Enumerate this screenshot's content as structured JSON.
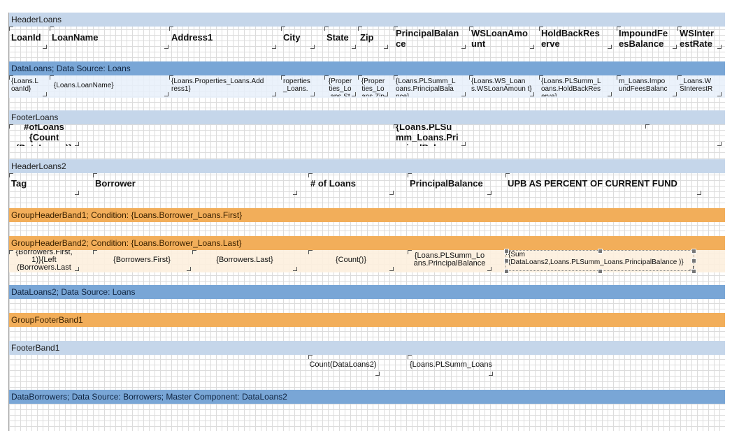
{
  "bands": {
    "header_loans": "HeaderLoans",
    "data_loans": "DataLoans; Data Source: Loans",
    "footer_loans": "FooterLoans",
    "header_loans2": "HeaderLoans2",
    "group_header_1": "GroupHeaderBand1; Condition: {Loans.Borrower_Loans.First}",
    "group_header_2": "GroupHeaderBand2; Condition: {Loans.Borrower_Loans.Last}",
    "data_loans2": "DataLoans2; Data Source: Loans",
    "group_footer_1": "GroupFooterBand1",
    "footer_band_1": "FooterBand1",
    "data_borrowers": "DataBorrowers; Data Source: Borrowers; Master Component: DataLoans2"
  },
  "header_loans": {
    "loan_id": "LoanId",
    "loan_name": "LoanName",
    "address1": "Address1",
    "city": "City",
    "state": "State",
    "zip": "Zip",
    "principal_balance": "PrincipalBalan ce",
    "ws_loan_amount": "WSLoanAmo unt",
    "holdback_reserve": "HoldBackRes erve",
    "impound_fees_balance": "ImpoundFe esBalance",
    "ws_interest_rate": "WSInter estRate"
  },
  "data_loans": {
    "loan_id": "{Loans.L oanId}",
    "loan_name": "{Loans.LoanName}",
    "address1": "{Loans.Properties_Loans.Add ress1}",
    "city": "roperties _Loans.",
    "state": "{Proper ties_Lo ans.St",
    "zip": "{Proper ties_Lo ans.Zip",
    "principal_balance": "{Loans.PLSumm_L oans.PrincipalBala nce}",
    "ws_loan_amount": "{Loans.WS_Loan s.WSLoanAmoun t}",
    "holdback_reserve": "{Loans.PLSumm_L oans.HoldBackRes erve}",
    "impound_fees_balance": "m_Loans.Impo undFeesBalanc",
    "ws_interest_rate": "_Loans.W SInterestR"
  },
  "footer_loans": {
    "count_loans": "#ofLoans {Count (DataLoans)}",
    "sum_principal": "{Loans.PLSu mm_Loans.Pri ncipalBalance"
  },
  "header_loans2": {
    "tag": "Tag",
    "borrower": "Borrower",
    "num_loans": "# of Loans",
    "principal_balance": "PrincipalBalance",
    "upb_percent": "UPB AS PERCENT OF CURRENT FUND"
  },
  "group_row": {
    "tag_expr": "{Borrowers.First, 1)}{Left (Borrowers.Last",
    "first": "{Borrowers.First}",
    "last": "{Borrowers.Last}",
    "count": "{Count()}",
    "principal": "{Loans.PLSumm_Lo ans.PrincipalBalance",
    "sum_expr": "{Sum (DataLoans2,Loans.PLSumm_Loans.PrincipalBalance )}"
  },
  "footer_band_1": {
    "count_expr": "Count(DataLoans2)",
    "sum_expr": "{Loans.PLSumm_Loans.l"
  }
}
